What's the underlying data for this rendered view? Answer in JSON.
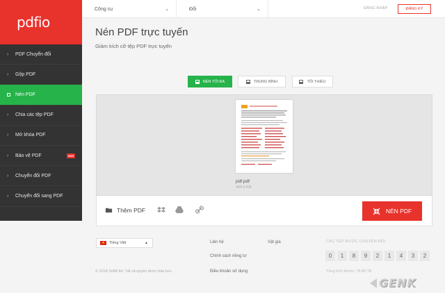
{
  "logo": "pdfio",
  "sidebar": {
    "items": [
      {
        "label": "PDF Chuyển đổi"
      },
      {
        "label": "Gộp PDF"
      },
      {
        "label": "Nén PDF"
      },
      {
        "label": "Chia các tệp PDF"
      },
      {
        "label": "Mở khóa PDF"
      },
      {
        "label": "Bảo vệ PDF",
        "badge": "MỚI"
      },
      {
        "label": "Chuyển đổi PDF"
      },
      {
        "label": "Chuyển đổi sang PDF"
      }
    ],
    "active_index": 2
  },
  "topbar": {
    "tools_label": "Công cụ",
    "convert_label": "Đổi",
    "login_label": "ĐĂNG NHẬP",
    "register_label": "ĐĂNG KÝ"
  },
  "header": {
    "title": "Nén PDF trực tuyến",
    "subtitle": "Giảm kích cỡ tệp PDF trực tuyến"
  },
  "modes": {
    "max": "NÉN TỐI ĐA",
    "medium": "TRUNG BÌNH",
    "min": "TỐI THIỂU",
    "selected": "max"
  },
  "file": {
    "name": "pdf.pdf",
    "size": "404.0 KB"
  },
  "actions": {
    "add_pdf": "Thêm PDF",
    "compress": "NÉN PDF"
  },
  "footer": {
    "language": "Tiếng Việt",
    "contact": "Liên hệ",
    "pricing": "Vật giá",
    "privacy": "Chính sách riêng tư",
    "terms": "Điều khoản sử dụng",
    "copyright": "© 2018 Soft9 ltd. Tất cả quyền được bảo lưu.",
    "counter_title": "CÁC TỆP ĐƯỢC CHUYỂN ĐỔI",
    "counter_digits": [
      "0",
      "1",
      "8",
      "9",
      "2",
      "1",
      "4",
      "3",
      "2"
    ],
    "total_size": "Tổng kích thước: 78.88 TB"
  },
  "watermark": "GENK",
  "colors": {
    "brand_red": "#e8322c",
    "active_green": "#26b34a",
    "sidebar_bg": "#333333"
  }
}
